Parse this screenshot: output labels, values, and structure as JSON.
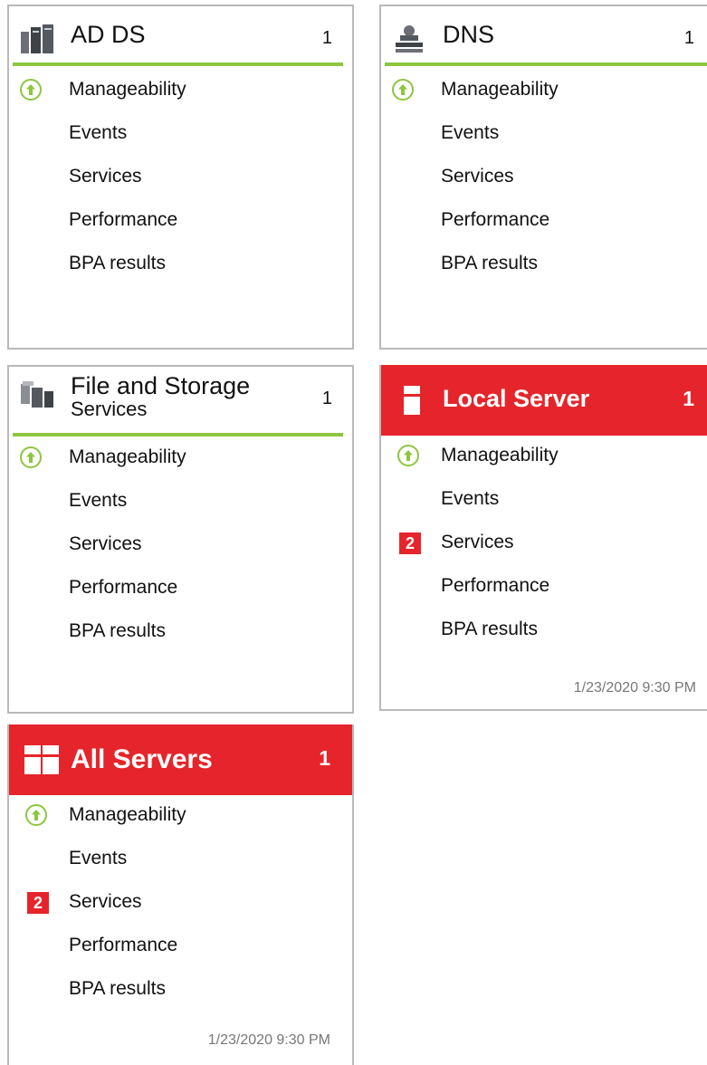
{
  "tiles": [
    {
      "title": "AD DS",
      "count": "1",
      "icon": "server-stack-icon",
      "rows": [
        "Manageability",
        "Events",
        "Services",
        "Performance",
        "BPA results"
      ]
    },
    {
      "title": "DNS",
      "count": "1",
      "icon": "dns-server-icon",
      "rows": [
        "Manageability",
        "Events",
        "Services",
        "Performance",
        "BPA results"
      ]
    },
    {
      "title": "File and Storage",
      "subtitle": "Services",
      "count": "1",
      "icon": "file-storage-icon",
      "rows": [
        "Manageability",
        "Events",
        "Services",
        "Performance",
        "BPA results"
      ]
    },
    {
      "title": "Local Server",
      "count": "1",
      "icon": "local-server-icon",
      "rows": [
        "Manageability",
        "Events",
        "Services",
        "Performance",
        "BPA results"
      ],
      "services_badge": "2",
      "timestamp": "1/23/2020 9:30 PM"
    },
    {
      "title": "All Servers",
      "count": "1",
      "icon": "all-servers-icon",
      "rows": [
        "Manageability",
        "Events",
        "Services",
        "Performance",
        "BPA results"
      ],
      "services_badge": "2",
      "timestamp": "1/23/2020 9:30 PM"
    }
  ],
  "colors": {
    "alert_red": "#e5252b",
    "ok_green": "#8dc63f",
    "border_gray": "#b9b9b9"
  }
}
